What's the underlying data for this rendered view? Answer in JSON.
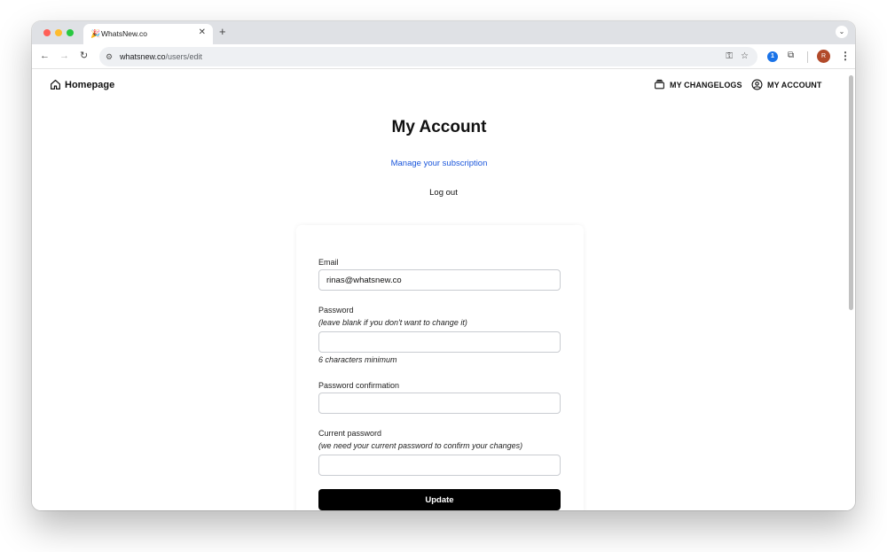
{
  "browser": {
    "tab_title": "WhatsNew.co",
    "tab_favicon": "🎉",
    "url_domain": "whatsnew.co",
    "url_path": "/users/edit",
    "extension_1p_label": "1",
    "avatar_label": "R"
  },
  "nav": {
    "home_label": "Homepage",
    "changelogs_label": "MY CHANGELOGS",
    "account_label": "MY ACCOUNT"
  },
  "page": {
    "title": "My Account",
    "manage_subscription": "Manage your subscription",
    "logout": "Log out"
  },
  "form": {
    "email_label": "Email",
    "email_value": "rinas@whatsnew.co",
    "password_label": "Password",
    "password_hint": "(leave blank if you don't want to change it)",
    "password_minimum": "6 characters minimum",
    "password_confirmation_label": "Password confirmation",
    "current_password_label": "Current password",
    "current_password_hint": "(we need your current password to confirm your changes)",
    "update_label": "Update"
  },
  "colors": {
    "link": "#1a56db",
    "button_bg": "#000000"
  }
}
